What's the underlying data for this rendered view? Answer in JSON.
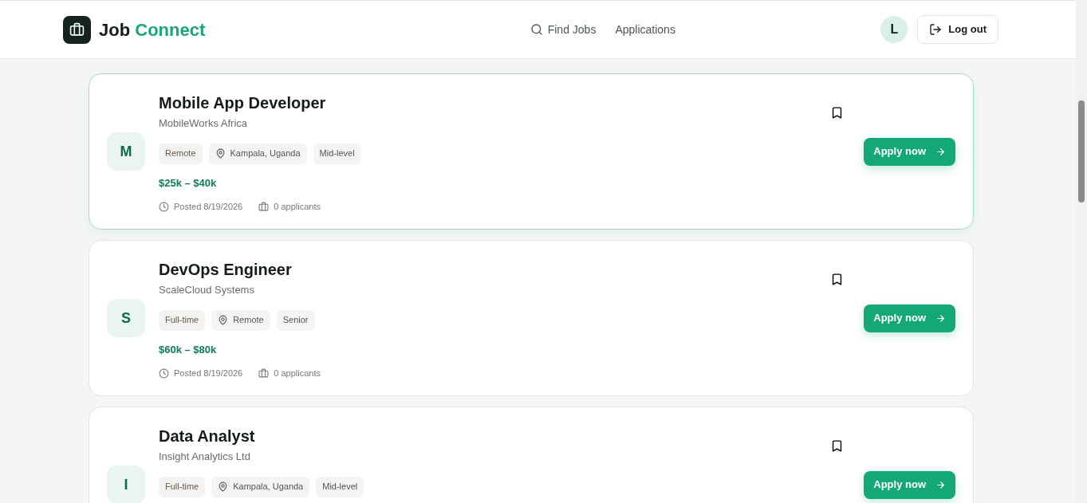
{
  "brand": {
    "first": "Job",
    "second": "Connect"
  },
  "nav": [
    {
      "label": "Find Jobs"
    },
    {
      "label": "Applications"
    }
  ],
  "user": {
    "initial": "L"
  },
  "logout": {
    "label": "Log out"
  },
  "jobs": [
    {
      "initial": "M",
      "title": "Mobile App Developer",
      "company": "MobileWorks Africa",
      "highlighted": true,
      "tags": [
        {
          "kind": "type",
          "label": "Remote"
        },
        {
          "kind": "location",
          "label": "Kampala, Uganda"
        },
        {
          "kind": "level",
          "label": "Mid-level"
        }
      ],
      "salary": "$25k – $40k",
      "posted": "Posted 8/19/2026",
      "applicants": "0 applicants",
      "apply": "Apply now"
    },
    {
      "initial": "S",
      "title": "DevOps Engineer",
      "company": "ScaleCloud Systems",
      "highlighted": false,
      "tags": [
        {
          "kind": "type",
          "label": "Full-time"
        },
        {
          "kind": "location",
          "label": "Remote"
        },
        {
          "kind": "level",
          "label": "Senior"
        }
      ],
      "salary": "$60k – $80k",
      "posted": "Posted 8/19/2026",
      "applicants": "0 applicants",
      "apply": "Apply now"
    },
    {
      "initial": "I",
      "title": "Data Analyst",
      "company": "Insight Analytics Ltd",
      "highlighted": false,
      "tags": [
        {
          "kind": "type",
          "label": "Full-time"
        },
        {
          "kind": "location",
          "label": "Kampala, Uganda"
        },
        {
          "kind": "level",
          "label": "Mid-level"
        }
      ],
      "apply": "Apply now"
    }
  ]
}
